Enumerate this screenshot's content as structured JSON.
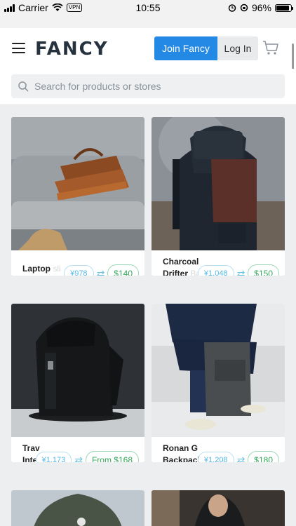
{
  "status_bar": {
    "carrier": "Carrier",
    "vpn": "VPN",
    "time": "10:55",
    "battery": "96%"
  },
  "header": {
    "logo": "FANCY",
    "join_label": "Join Fancy",
    "login_label": "Log In"
  },
  "search": {
    "placeholder": "Search for products or stores"
  },
  "products": [
    {
      "title_visible": "Laptop",
      "title_faded": " sli",
      "original_price": "¥978",
      "converted_price": "$140"
    },
    {
      "title_visible": "Charcoal",
      "title_faded": "",
      "title_line2": "Drifter",
      "title_line2_faded": " Ba",
      "original_price": "¥1,048",
      "converted_price": "$150"
    },
    {
      "title_visible": "Trav",
      "title_line2": "Integ",
      "original_price": "¥1,173",
      "converted_price": "From $168"
    },
    {
      "title_visible": "Ronan G",
      "title_line2": "Backpack",
      "original_price": "¥1,208",
      "converted_price": "$180"
    }
  ],
  "colors": {
    "accent": "#2489e5",
    "price_blue": "#55b8e3",
    "price_green": "#33a65a"
  }
}
